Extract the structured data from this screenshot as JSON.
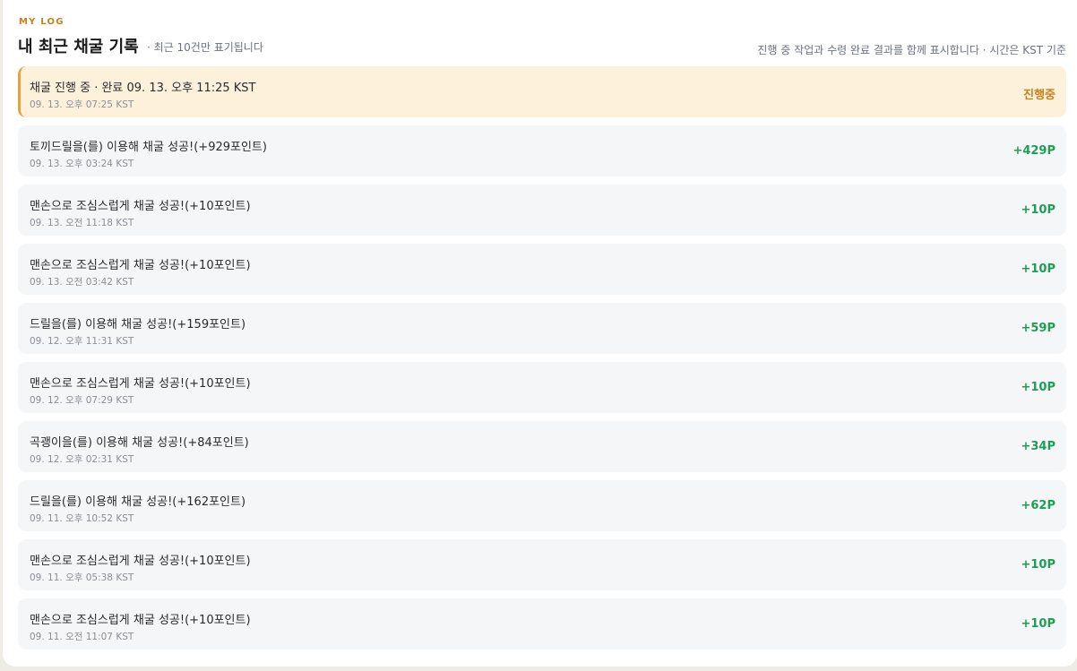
{
  "header": {
    "eyebrow": "MY LOG",
    "title": "내 최근 채굴 기록",
    "subtitle": "· 최근 10건만 표기됩니다",
    "note": "진행 중 작업과 수령 완료 결과를 함께 표시합니다 · 시간은 KST 기준"
  },
  "colors": {
    "accent": "#c8811a",
    "active_bg": "#fdf1dc",
    "active_border": "#e6a23c",
    "success": "#1f9d55",
    "row_bg": "#f5f6f8"
  },
  "rows": [
    {
      "text": "채굴 진행 중 · 완료 09. 13. 오후 11:25 KST",
      "time": "09. 13. 오후 07:25 KST",
      "value": "진행중",
      "status": "active"
    },
    {
      "text": "토끼드릴을(를) 이용해 채굴 성공!(+929포인트)",
      "time": "09. 13. 오후 03:24 KST",
      "value": "+429P",
      "status": "done"
    },
    {
      "text": "맨손으로 조심스럽게 채굴 성공!(+10포인트)",
      "time": "09. 13. 오전 11:18 KST",
      "value": "+10P",
      "status": "done"
    },
    {
      "text": "맨손으로 조심스럽게 채굴 성공!(+10포인트)",
      "time": "09. 13. 오전 03:42 KST",
      "value": "+10P",
      "status": "done"
    },
    {
      "text": "드릴을(를) 이용해 채굴 성공!(+159포인트)",
      "time": "09. 12. 오후 11:31 KST",
      "value": "+59P",
      "status": "done"
    },
    {
      "text": "맨손으로 조심스럽게 채굴 성공!(+10포인트)",
      "time": "09. 12. 오후 07:29 KST",
      "value": "+10P",
      "status": "done"
    },
    {
      "text": "곡괭이을(를) 이용해 채굴 성공!(+84포인트)",
      "time": "09. 12. 오후 02:31 KST",
      "value": "+34P",
      "status": "done"
    },
    {
      "text": "드릴을(를) 이용해 채굴 성공!(+162포인트)",
      "time": "09. 11. 오후 10:52 KST",
      "value": "+62P",
      "status": "done"
    },
    {
      "text": "맨손으로 조심스럽게 채굴 성공!(+10포인트)",
      "time": "09. 11. 오후 05:38 KST",
      "value": "+10P",
      "status": "done"
    },
    {
      "text": "맨손으로 조심스럽게 채굴 성공!(+10포인트)",
      "time": "09. 11. 오전 11:07 KST",
      "value": "+10P",
      "status": "done"
    }
  ]
}
